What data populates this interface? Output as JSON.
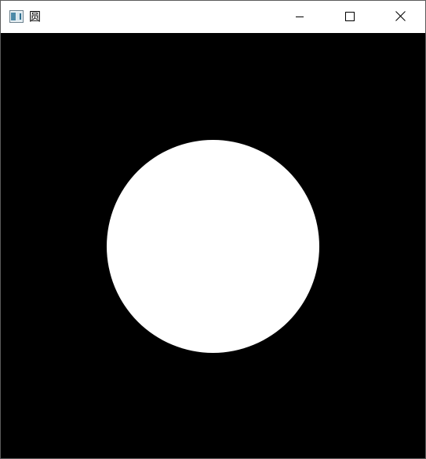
{
  "window": {
    "title": "圆",
    "controls": {
      "minimize_icon": "minimize-icon",
      "maximize_icon": "maximize-icon",
      "close_icon": "close-icon"
    }
  },
  "canvas": {
    "background_color": "#000000",
    "shape": "circle",
    "shape_color": "#ffffff"
  }
}
